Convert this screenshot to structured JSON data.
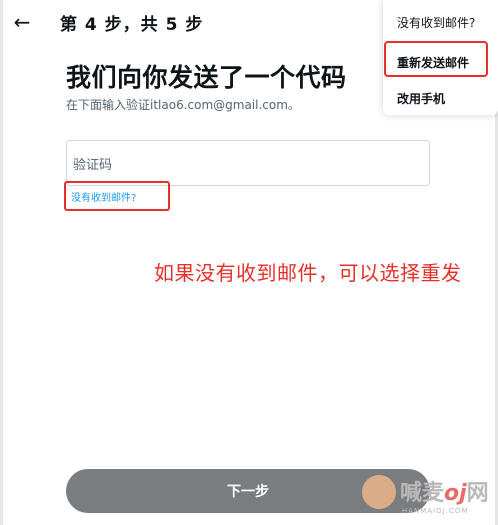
{
  "header": {
    "back_icon": "arrow-left-icon",
    "step_title": "第 4 步，共 5 步"
  },
  "main": {
    "heading": "我们向你发送了一个代码",
    "subtext": "在下面输入验证itlao6.com@gmail.com。",
    "code_placeholder": "验证码",
    "no_email_link": "没有收到邮件?"
  },
  "menu": {
    "items": [
      "没有收到邮件?",
      "重新发送邮件",
      "改用手机"
    ]
  },
  "annotation": "如果没有收到邮件，可以选择重发",
  "footer": {
    "next_label": "下一步"
  },
  "watermark": {
    "text_main": "喊麦",
    "text_oj": "oj",
    "text_tail": "网",
    "url": "HANMAIOJ.COM"
  },
  "colors": {
    "accent": "#1d9bf0",
    "highlight_red": "#e8302a",
    "button_grey": "#7a7d80"
  }
}
